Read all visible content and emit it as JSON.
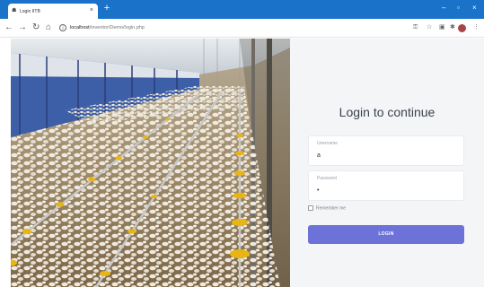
{
  "browser": {
    "tab_title": "Login IITB",
    "url_host": "localhost",
    "url_path": "/inventor/Demo/login.php",
    "icons": [
      "back-icon",
      "forward-icon",
      "reload-icon",
      "home-icon",
      "info-icon",
      "key-icon",
      "star-icon",
      "extension-icon",
      "puzzle-icon",
      "avatar",
      "menu-icon"
    ]
  },
  "login": {
    "title": "Login to continue",
    "username_label": "Username",
    "username_value": "a",
    "password_label": "Password",
    "password_value": "•",
    "remember_label": "Remember me",
    "button_label": "LOGIN"
  },
  "colors": {
    "chrome_blue": "#1a73c9",
    "button": "#6c72d8",
    "panel_bg": "#f4f5f7"
  }
}
